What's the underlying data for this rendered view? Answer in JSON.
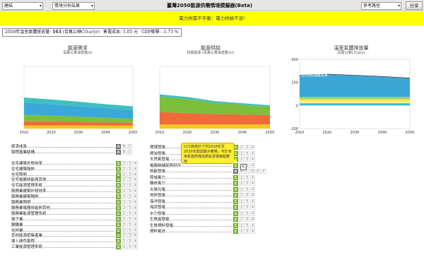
{
  "toolbar": {
    "region_select": "建結",
    "scenario_select": "情境分析結果",
    "app_title": "臺灣2050能源供需情境模擬器(Beta)",
    "path_select": "參考路徑",
    "share_label": "分享"
  },
  "warning": "電力供需不平衡：電力供給不足!",
  "summary": {
    "prefix": "2050年溫室氣體排放量",
    "emission": "163",
    "emission_unit": "(百萬公噸CO₂e/yr)",
    "cost": "售電成本: 5.05 元",
    "gdp": "GDP衝擊: -1.73 %"
  },
  "charts": [
    {
      "title": "能源需求",
      "subtitle": "百萬公秉油當量/yr"
    },
    {
      "title": "能源供給",
      "subtitle": "初級能源 (百萬公秉油當量/yr)"
    },
    {
      "title": "溫室氣體排放量",
      "subtitle": "百萬公噸CO₂e/yr",
      "annotation": "2005年排放水準"
    }
  ],
  "chart_data": [
    {
      "type": "area",
      "x": [
        2010,
        2020,
        2030,
        2040,
        2050
      ],
      "ylim": [
        0,
        120
      ],
      "series": [
        {
          "color": "#f7c81e",
          "values": [
            6,
            6,
            6,
            6,
            6
          ]
        },
        {
          "color": "#f06a3c",
          "values": [
            8,
            8,
            7,
            6,
            5
          ]
        },
        {
          "color": "#7dbe3c",
          "values": [
            12,
            11,
            10,
            9,
            8
          ]
        },
        {
          "color": "#3aa8d8",
          "values": [
            24,
            22,
            20,
            18,
            16
          ]
        },
        {
          "color": "#3fbfbf",
          "values": [
            10,
            9,
            9,
            8,
            8
          ]
        }
      ],
      "xticks": [
        "2010",
        "2020",
        "2030",
        "2040",
        "2050"
      ]
    },
    {
      "type": "area",
      "x": [
        2010,
        2020,
        2030,
        2040,
        2050
      ],
      "ylim": [
        0,
        120
      ],
      "series": [
        {
          "color": "#f7c81e",
          "values": [
            8,
            8,
            8,
            8,
            8
          ]
        },
        {
          "color": "#f06a3c",
          "values": [
            24,
            22,
            20,
            19,
            18
          ]
        },
        {
          "color": "#7dbe3c",
          "values": [
            30,
            27,
            22,
            19,
            16
          ]
        },
        {
          "color": "#3fbfbf",
          "values": [
            4,
            4,
            3,
            3,
            3
          ]
        }
      ],
      "xticks": [
        "2010",
        "2020",
        "2030",
        "2040",
        "2050"
      ]
    },
    {
      "type": "area",
      "x": [
        2010,
        2020,
        2030,
        2040,
        2050
      ],
      "ylim": [
        -200,
        400
      ],
      "yticks": [
        "400",
        "200",
        "0",
        "-200"
      ],
      "series": [
        {
          "color": "#33bbdd",
          "values": [
            20,
            20,
            20,
            20,
            20
          ]
        },
        {
          "color": "#fff1a6",
          "values": [
            15,
            15,
            15,
            15,
            15
          ]
        },
        {
          "color": "#f7e84a",
          "values": [
            20,
            20,
            20,
            20,
            20
          ]
        },
        {
          "color": "#9ed06a",
          "values": [
            20,
            20,
            20,
            20,
            20
          ]
        },
        {
          "color": "#3ba6d6",
          "values": [
            185,
            195,
            185,
            175,
            160
          ]
        },
        {
          "color": "#222222",
          "values": [
            4,
            4,
            4,
            4,
            4
          ]
        }
      ],
      "xticks": [
        "2010",
        "2020",
        "2030",
        "2040",
        "2050"
      ]
    }
  ],
  "levers_left": [
    {
      "label": "經濟成長",
      "choices": [
        "A",
        "B",
        "C"
      ],
      "selected": 0,
      "style": "d"
    },
    {
      "label": "製程產業結構",
      "choices": [
        "A",
        "B",
        "C"
      ],
      "selected": 0,
      "style": "d"
    },
    {
      "label": "",
      "choices": [],
      "selected": -1,
      "style": ""
    },
    {
      "label": "住宅建築外殼效率",
      "choices": [
        "1",
        "2",
        "3",
        "4"
      ],
      "selected": 0,
      "style": "g"
    },
    {
      "label": "住宅建築隔熱",
      "choices": [
        "1",
        "2",
        "3",
        "4"
      ],
      "selected": 0,
      "style": "g"
    },
    {
      "label": "住宅照明",
      "choices": [
        "1",
        "2",
        "3",
        "4"
      ],
      "selected": 0,
      "style": "g"
    },
    {
      "label": "住宅電器效能與其他",
      "choices": [
        "1",
        "2",
        "3",
        "4"
      ],
      "selected": 0,
      "style": "g"
    },
    {
      "label": "住宅能源管理系統",
      "choices": [
        "1",
        "2",
        "3",
        "4"
      ],
      "selected": 0,
      "style": "g"
    },
    {
      "label": "服務業建築外殼效率",
      "choices": [
        "1",
        "2",
        "3",
        "4"
      ],
      "selected": 0,
      "style": "g"
    },
    {
      "label": "服務業建築隔熱",
      "choices": [
        "1",
        "2",
        "3",
        "4"
      ],
      "selected": 0,
      "style": "g"
    },
    {
      "label": "服務業照明",
      "choices": [
        "1",
        "2",
        "3",
        "4"
      ],
      "selected": 0,
      "style": "g"
    },
    {
      "label": "服務業電器效能與其他",
      "choices": [
        "1",
        "2",
        "3",
        "4"
      ],
      "selected": 0,
      "style": "g"
    },
    {
      "label": "服務業能源管理系統",
      "choices": [
        "1",
        "2",
        "3",
        "4"
      ],
      "selected": 0,
      "style": "g"
    },
    {
      "label": "電子業",
      "choices": [
        "1",
        "2",
        "3",
        "4"
      ],
      "selected": 0,
      "style": "g"
    },
    {
      "label": "鋼鐵業",
      "choices": [
        "1",
        "2",
        "3",
        "4"
      ],
      "selected": 0,
      "style": "g"
    },
    {
      "label": "化材業",
      "choices": [
        "1",
        "2",
        "3",
        "4"
      ],
      "selected": 0,
      "style": "g"
    },
    {
      "label": "其他能源密集產業",
      "choices": [
        "1",
        "2",
        "3",
        "4"
      ],
      "selected": 0,
      "style": "g"
    },
    {
      "label": "導入綠色製程",
      "choices": [
        "1",
        "2",
        "3",
        "4"
      ],
      "selected": 0,
      "style": "g"
    },
    {
      "label": "工業能源管理系統",
      "choices": [
        "1",
        "2",
        "3",
        "4"
      ],
      "selected": 0,
      "style": "g"
    }
  ],
  "levers_right": [
    {
      "label": "燃煤發電",
      "choices": [
        "1",
        "2",
        "3",
        "4"
      ],
      "selected": 0,
      "style": "g"
    },
    {
      "label": "燃油發電",
      "choices": [
        "1",
        "2",
        "3",
        "4"
      ],
      "selected": 0,
      "style": "g"
    },
    {
      "label": "天然氣發電",
      "choices": [
        "1",
        "2",
        "3",
        "4"
      ],
      "selected": 0,
      "style": "g"
    },
    {
      "label": "電廠碳捕捉與封存",
      "choices": [
        "1",
        "2",
        "3",
        "4"
      ],
      "selected": 0,
      "style": "g"
    },
    {
      "label": "核能發電",
      "choices": [
        "A",
        "B",
        "C",
        "D",
        "E",
        "F"
      ],
      "selected": 0,
      "style": "d"
    },
    {
      "label": "陸域風力",
      "choices": [
        "1",
        "2",
        "3",
        "4"
      ],
      "selected": 0,
      "style": "g"
    },
    {
      "label": "離岸風力",
      "choices": [
        "1",
        "2",
        "3",
        "4"
      ],
      "selected": 0,
      "style": "g"
    },
    {
      "label": "太陽光電",
      "choices": [
        "1",
        "2",
        "3",
        "4"
      ],
      "selected": 0,
      "style": "g"
    },
    {
      "label": "地熱發電",
      "choices": [
        "1",
        "2",
        "3",
        "4"
      ],
      "selected": 0,
      "style": "g"
    },
    {
      "label": "海洋發電",
      "choices": [
        "1",
        "2",
        "3",
        "4"
      ],
      "selected": 0,
      "style": "g"
    },
    {
      "label": "海流發電",
      "choices": [
        "1",
        "2",
        "3",
        "4"
      ],
      "selected": 0,
      "style": "g"
    },
    {
      "label": "水力發電",
      "choices": [
        "1",
        "2",
        "3",
        "4"
      ],
      "selected": 0,
      "style": "g"
    },
    {
      "label": "生質能發電",
      "choices": [
        "1",
        "2",
        "3",
        "4"
      ],
      "selected": 0,
      "style": "g"
    },
    {
      "label": "生質燃料發電",
      "choices": [
        "1",
        "2",
        "3",
        "4"
      ],
      "selected": 0,
      "style": "g"
    },
    {
      "label": "燃料電池",
      "choices": [
        "1",
        "2",
        "3",
        "4"
      ],
      "selected": 0,
      "style": "g"
    }
  ],
  "tooltip": "CCS技術於下列2018年至2020年間試驗示範場，可於未來新建燃煤與燃氣發電機組應用",
  "cursor_glyph": "↖"
}
